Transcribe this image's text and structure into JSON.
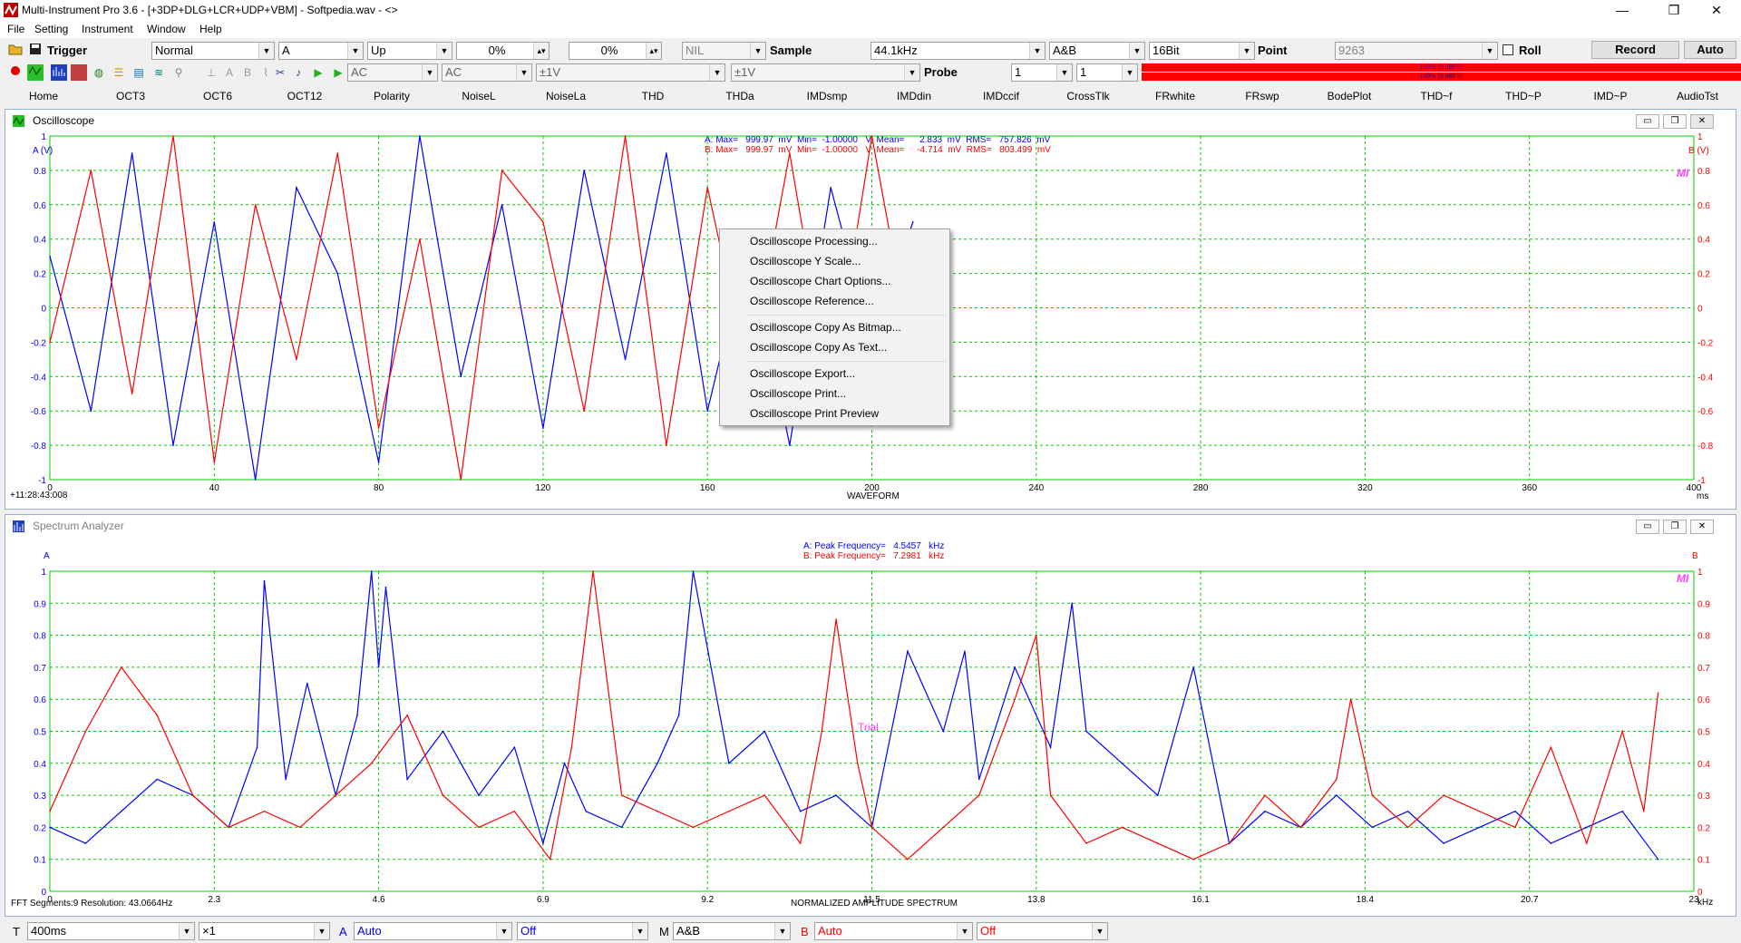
{
  "window": {
    "title": "Multi-Instrument Pro 3.6   - [+3DP+DLG+LCR+UDP+VBM]   - Softpedia.wav  - <>",
    "min": "—",
    "max": "❐",
    "close": "✕"
  },
  "menu": [
    "File",
    "Setting",
    "Instrument",
    "Window",
    "Help"
  ],
  "toolbar1": {
    "trigger_label": "Trigger",
    "trigger_mode": "Normal",
    "trigger_channel": "A",
    "trigger_edge": "Up",
    "trigger_level": "0%",
    "trigger_delay": "0%",
    "nil": "NIL",
    "sample_label": "Sample",
    "sample_rate": "44.1kHz",
    "channels": "A&B",
    "bits": "16Bit",
    "point_label": "Point",
    "points": "9263",
    "roll_label": "Roll",
    "record_label": "Record",
    "auto_label": "Auto"
  },
  "toolbar2": {
    "coupling_a": "AC",
    "coupling_b": "AC",
    "range_a": "±1V",
    "range_b": "±1V",
    "probe_label": "Probe",
    "probe_a": "1",
    "probe_b": "1",
    "level_a_text": "100% (0 dBFS)",
    "level_b_text": "100% (0 dBFS)"
  },
  "tabs": [
    "Home",
    "OCT3",
    "OCT6",
    "OCT12",
    "Polarity",
    "NoiseL",
    "NoiseLa",
    "THD",
    "THDa",
    "IMDsmp",
    "IMDdin",
    "IMDccif",
    "CrossTlk",
    "FRwhite",
    "FRswp",
    "BodePlot",
    "THD~f",
    "THD~P",
    "IMD~P",
    "AudioTst"
  ],
  "oscilloscope": {
    "title": "Oscilloscope",
    "stats_a": "A: Max=   999.97  mV  Min=  -1.00000   V  Mean=      2.833  mV  RMS=   757.826  mV",
    "stats_b": "B: Max=   999.97  mV  Min=  -1.00000   V  Mean=     -4.714  mV  RMS=   803.499  mV",
    "y_label_left": "A (V)",
    "y_label_right": "B (V)",
    "y_ticks": [
      "1",
      "0.8",
      "0.6",
      "0.4",
      "0.2",
      "0",
      "-0.2",
      "-0.4",
      "-0.6",
      "-0.8",
      "-1"
    ],
    "x_ticks": [
      "0",
      "40",
      "80",
      "120",
      "160",
      "200",
      "240",
      "280",
      "320",
      "360",
      "400"
    ],
    "x_unit": "ms",
    "x_title": "WAVEFORM",
    "timestamp": "+11:28:43:008",
    "mi_mark": "MI"
  },
  "context_menu": [
    "Oscilloscope Processing...",
    "Oscilloscope Y Scale...",
    "Oscilloscope Chart Options...",
    "Oscilloscope Reference...",
    "Oscilloscope Copy As Bitmap...",
    "Oscilloscope Copy As Text...",
    "Oscilloscope Export...",
    "Oscilloscope Print...",
    "Oscilloscope Print Preview"
  ],
  "spectrum": {
    "title": "Spectrum Analyzer",
    "peak_a": "A: Peak Frequency=   4.5457   kHz",
    "peak_b": "B: Peak Frequency=   7.2981   kHz",
    "y_label_left": "A",
    "y_label_right": "B",
    "y_ticks": [
      "1",
      "0.9",
      "0.8",
      "0.7",
      "0.6",
      "0.5",
      "0.4",
      "0.3",
      "0.2",
      "0.1",
      "0"
    ],
    "x_ticks": [
      "0",
      "2.3",
      "4.6",
      "6.9",
      "9.2",
      "11.5",
      "13.8",
      "16.1",
      "18.4",
      "20.7",
      "23"
    ],
    "x_unit": "kHz",
    "x_title": "NORMALIZED AMPLITUDE SPECTRUM",
    "fft_info": "FFT Segments:9     Resolution: 43.0664Hz",
    "trial": "Trial",
    "mi_mark": "MI"
  },
  "bottombar": {
    "t_label": "T",
    "timebase": "400ms",
    "x_zoom": "×1",
    "a_label": "A",
    "a_scale": "Auto",
    "a_off": "Off",
    "m_label": "M",
    "m_value": "A&B",
    "b_label": "B",
    "b_scale": "Auto",
    "b_off": "Off"
  },
  "colors": {
    "channel_a": "#0000ff",
    "channel_b": "#ff0000",
    "grid": "#00cc00",
    "mi": "#ff00ff"
  },
  "chart_data": [
    {
      "type": "line",
      "title": "WAVEFORM",
      "xlabel": "ms",
      "ylabel": "A (V)",
      "xlim": [
        0,
        400
      ],
      "ylim": [
        -1,
        1
      ],
      "note": "",
      "series": [
        {
          "name": "A",
          "color": "#0000ff",
          "x": [
            0,
            10,
            20,
            30,
            40,
            50,
            60,
            70,
            80,
            90,
            100,
            110,
            120,
            130,
            140,
            150,
            160,
            170,
            180,
            190,
            200,
            210
          ],
          "values": [
            0.3,
            -0.6,
            0.9,
            -0.8,
            0.5,
            -1,
            0.7,
            0.2,
            -0.9,
            1,
            -0.4,
            0.6,
            -0.7,
            0.8,
            -0.3,
            0.9,
            -0.6,
            0.4,
            -0.8,
            0.7,
            -0.2,
            0.5
          ]
        },
        {
          "name": "B",
          "color": "#ff0000",
          "x": [
            0,
            10,
            20,
            30,
            40,
            50,
            60,
            70,
            80,
            90,
            100,
            110,
            120,
            130,
            140,
            150,
            160,
            170,
            180,
            190,
            200,
            210
          ],
          "values": [
            -0.2,
            0.8,
            -0.5,
            1,
            -0.9,
            0.6,
            -0.3,
            0.9,
            -0.7,
            0.4,
            -1,
            0.8,
            0.5,
            -0.6,
            1,
            -0.8,
            0.7,
            -0.4,
            0.9,
            -0.5,
            1,
            -0.3
          ]
        }
      ]
    },
    {
      "type": "line",
      "title": "NORMALIZED AMPLITUDE SPECTRUM",
      "xlabel": "kHz",
      "ylabel": "A",
      "xlim": [
        0,
        23
      ],
      "ylim": [
        0,
        1
      ],
      "series": [
        {
          "name": "A",
          "color": "#0000ff",
          "x": [
            0,
            0.5,
            1,
            1.5,
            2,
            2.5,
            2.9,
            3,
            3.3,
            3.6,
            4,
            4.3,
            4.5,
            4.6,
            4.7,
            5,
            5.5,
            6,
            6.5,
            6.9,
            7.2,
            7.5,
            8,
            8.5,
            8.8,
            9,
            9.5,
            10,
            10.5,
            11,
            11.5,
            12,
            12.5,
            12.8,
            13,
            13.5,
            14,
            14.3,
            14.5,
            15,
            15.5,
            16,
            16.5,
            17,
            17.5,
            18,
            18.5,
            19,
            19.5,
            20,
            20.5,
            21,
            21.5,
            22,
            22.5
          ],
          "values": [
            0.2,
            0.15,
            0.25,
            0.35,
            0.3,
            0.2,
            0.45,
            0.97,
            0.35,
            0.65,
            0.3,
            0.55,
            1.0,
            0.7,
            0.95,
            0.35,
            0.5,
            0.3,
            0.45,
            0.15,
            0.4,
            0.25,
            0.2,
            0.4,
            0.55,
            1.0,
            0.4,
            0.5,
            0.25,
            0.3,
            0.2,
            0.75,
            0.5,
            0.75,
            0.35,
            0.7,
            0.45,
            0.9,
            0.5,
            0.4,
            0.3,
            0.7,
            0.15,
            0.25,
            0.2,
            0.3,
            0.2,
            0.25,
            0.15,
            0.2,
            0.25,
            0.15,
            0.2,
            0.25,
            0.1
          ]
        },
        {
          "name": "B",
          "color": "#ff0000",
          "x": [
            0,
            0.5,
            1,
            1.5,
            2,
            2.5,
            3,
            3.5,
            4,
            4.5,
            5,
            5.5,
            6,
            6.5,
            7,
            7.3,
            7.6,
            8,
            8.5,
            9,
            9.5,
            10,
            10.5,
            10.8,
            11,
            11.3,
            11.5,
            12,
            12.5,
            13,
            13.5,
            13.8,
            14,
            14.5,
            15,
            15.5,
            16,
            16.5,
            17,
            17.5,
            18,
            18.2,
            18.5,
            19,
            19.5,
            20,
            20.5,
            21,
            21.5,
            22,
            22.3,
            22.5
          ],
          "values": [
            0.25,
            0.5,
            0.7,
            0.55,
            0.3,
            0.2,
            0.25,
            0.2,
            0.3,
            0.4,
            0.55,
            0.3,
            0.2,
            0.25,
            0.1,
            0.45,
            1.0,
            0.3,
            0.25,
            0.2,
            0.25,
            0.3,
            0.15,
            0.5,
            0.85,
            0.4,
            0.2,
            0.1,
            0.2,
            0.3,
            0.6,
            0.8,
            0.3,
            0.15,
            0.2,
            0.15,
            0.1,
            0.15,
            0.3,
            0.2,
            0.35,
            0.6,
            0.3,
            0.2,
            0.3,
            0.25,
            0.2,
            0.45,
            0.15,
            0.5,
            0.25,
            0.62
          ]
        }
      ]
    }
  ]
}
